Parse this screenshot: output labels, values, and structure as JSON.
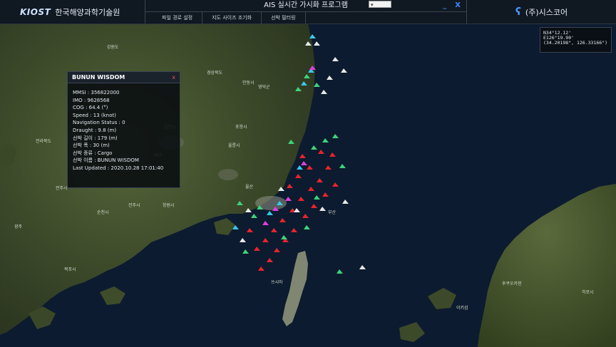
{
  "header": {
    "org_logo": "KIOST",
    "org_name": "한국해양과학기술원",
    "app_title": "AIS 실시간 가시화 프로그램",
    "menu": [
      "파일 경로 설정",
      "지도 사이즈 조기화",
      "선박 필터링"
    ],
    "minimize_label": "_",
    "close_label": "X",
    "company_name": "(주)시스코어"
  },
  "coords": {
    "lat": "N34°12.12'",
    "lon": "E126°19.90'",
    "decimal": "(34.20198°, 126.33166°)"
  },
  "vessel_info": {
    "name": "BUNUN WISDOM",
    "close_label": "x",
    "rows": [
      "MMSI : 356822000",
      "IMO : 9628568",
      "COG : 64.4 (°)",
      "Speed : 13 (knot)",
      "Navigation Status : 0",
      "Draught : 9.8 (m)",
      "선박 길이 : 179 (m)",
      "선박 폭 : 30 (m)",
      "선박 종류 : Cargo",
      "선박 이름 : BUNUN WISDOM",
      "Last Updated : 2020.10.28 17:01:40"
    ]
  },
  "colors": {
    "ship_red": "#e8242c",
    "ship_green": "#3fd27a",
    "ship_cyan": "#39c8e8",
    "ship_magenta": "#e040e0",
    "ship_white": "#e8e8e8",
    "accent_blue": "#3b8bff"
  }
}
